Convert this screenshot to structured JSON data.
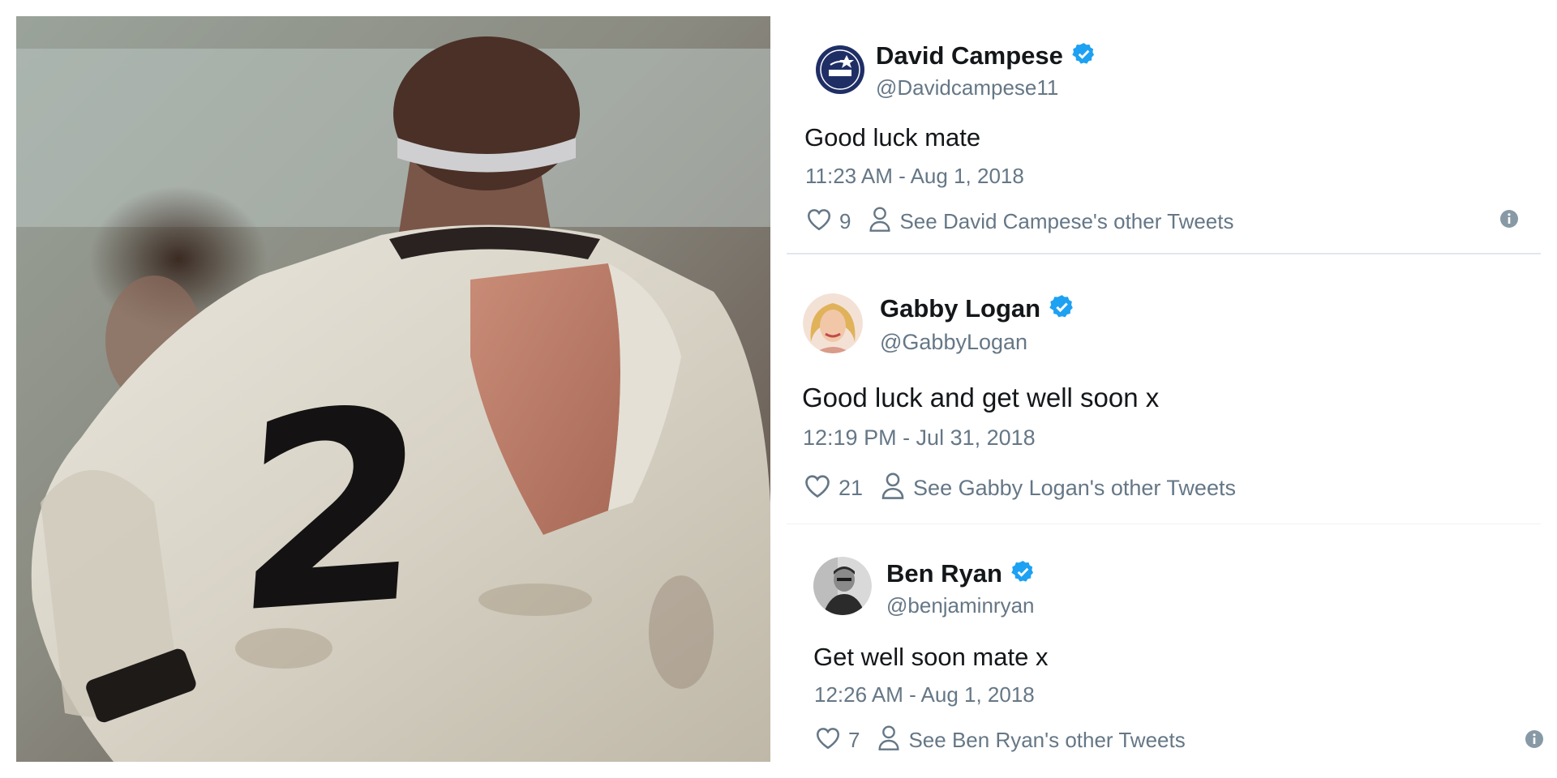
{
  "tweets": [
    {
      "name": "David Campese",
      "handle": "@Davidcampese11",
      "text": "Good luck mate",
      "time": "11:23 AM - Aug 1, 2018",
      "likes": "9",
      "other_link": "See David Campese's other Tweets",
      "verified": true
    },
    {
      "name": "Gabby Logan",
      "handle": "@GabbyLogan",
      "text": "Good luck and get well soon x",
      "time": "12:19 PM - Jul 31, 2018",
      "likes": "21",
      "other_link": "See Gabby Logan's other Tweets",
      "verified": true
    },
    {
      "name": "Ben Ryan",
      "handle": "@benjaminryan",
      "text": "Get well soon mate x",
      "time": "12:26 AM - Aug 1, 2018",
      "likes": "7",
      "other_link": "See Ben Ryan's other Tweets",
      "verified": true
    }
  ],
  "photo": {
    "jersey_number": "2"
  },
  "colors": {
    "verified_blue": "#1da1f2",
    "secondary_text": "#657786",
    "primary_text": "#14171a",
    "divider": "#e1e8ed"
  },
  "icons": [
    "heart-icon",
    "person-icon",
    "info-icon",
    "verified-badge-icon"
  ]
}
